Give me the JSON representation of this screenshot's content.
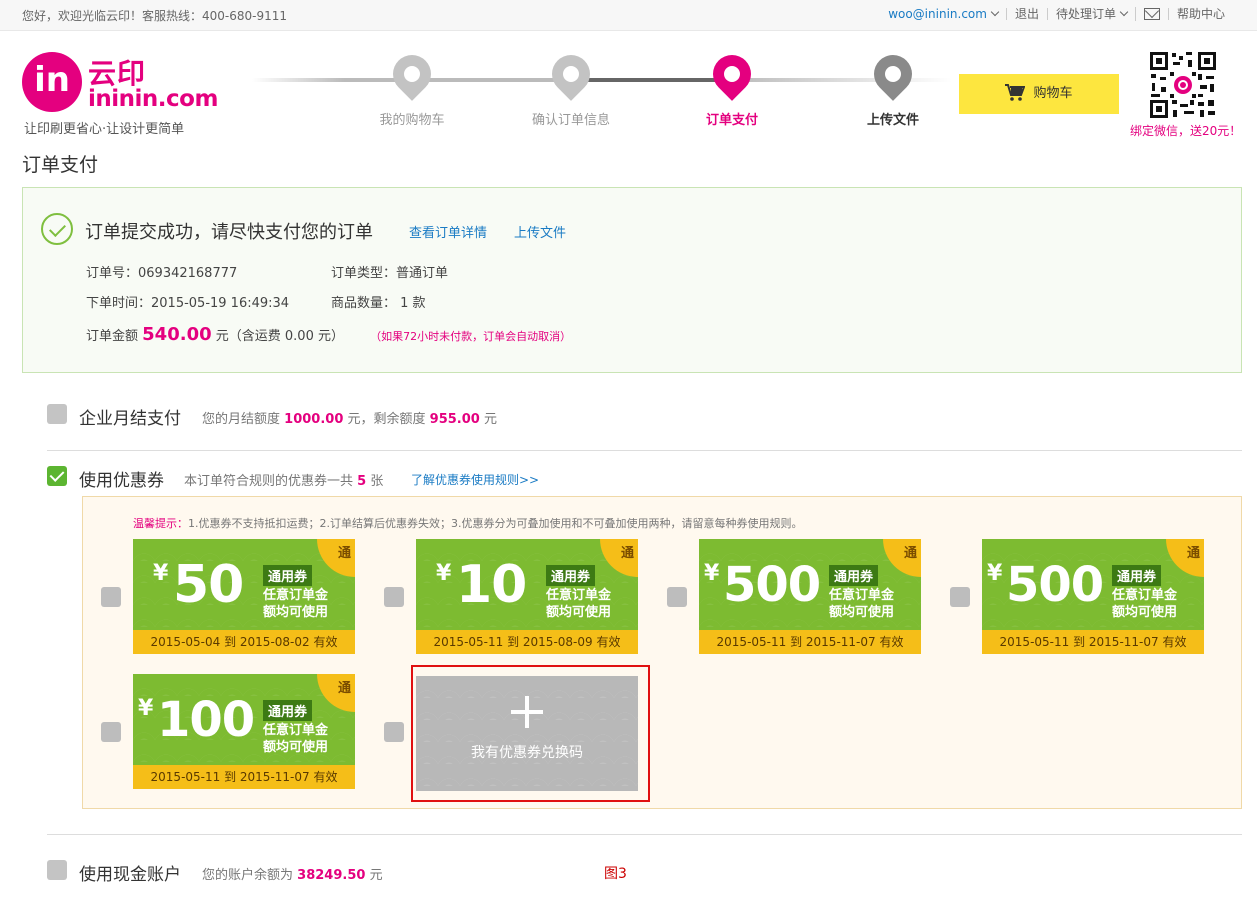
{
  "topbar": {
    "welcome": "您好，欢迎光临云印！客服热线：400-680-9111",
    "email": "woo@ininin.com",
    "logout": "退出",
    "pending": "待处理订单",
    "help": "帮助中心"
  },
  "logo": {
    "mark": "in",
    "cn": "云印",
    "en": "ininin.com",
    "slogan": "让印刷更省心·让设计更简单"
  },
  "steps": [
    {
      "label": "我的购物车",
      "state": "done"
    },
    {
      "label": "确认订单信息",
      "state": "done"
    },
    {
      "label": "订单支付",
      "state": "active"
    },
    {
      "label": "上传文件",
      "state": "todo"
    }
  ],
  "cart_label": "购物车",
  "qr_note": "绑定微信，送20元！",
  "page_title": "订单支付",
  "order": {
    "headline": "订单提交成功，请尽快支付您的订单",
    "view_detail": "查看订单详情",
    "upload": "上传文件",
    "number": "订单号：069342168777",
    "type": "订单类型：普通订单",
    "time": "下单时间：2015-05-19 16:49:34",
    "qty": "商品数量：  1 款",
    "amount_label": "订单金额",
    "amount": "540.00",
    "amount_suffix": "元（含运费 0.00 元）",
    "warning": "（如果72小时未付款，订单会自动取消）"
  },
  "enterprise": {
    "title": "企业月结支付",
    "note_a": "您的月结额度",
    "limit": "1000.00",
    "note_b": "元，剩余额度",
    "remain": "955.00",
    "note_c": "元"
  },
  "coupon_opt": {
    "title": "使用优惠券",
    "note_a": "本订单符合规则的优惠券一共",
    "count": "5",
    "note_b": "张",
    "link": "了解优惠券使用规则>>"
  },
  "tip": {
    "head": "温馨提示：",
    "text": "1.优惠券不支持抵扣运费；2.订单结算后优惠券失效；3.优惠券分为可叠加使用和不可叠加使用两种，请留意每种券使用规则。"
  },
  "coupons": [
    {
      "yen": "¥",
      "value": "50",
      "tag": "通用券",
      "line1": "任意订单金",
      "line2": "额均可使用",
      "corner": "通",
      "validity": "2015-05-04 到 2015-08-02 有效"
    },
    {
      "yen": "¥",
      "value": "10",
      "tag": "通用券",
      "line1": "任意订单金",
      "line2": "额均可使用",
      "corner": "通",
      "validity": "2015-05-11 到 2015-08-09 有效"
    },
    {
      "yen": "¥",
      "value": "500",
      "tag": "通用券",
      "line1": "任意订单金",
      "line2": "额均可使用",
      "corner": "通",
      "validity": "2015-05-11 到 2015-11-07 有效"
    },
    {
      "yen": "¥",
      "value": "500",
      "tag": "通用券",
      "line1": "任意订单金",
      "line2": "额均可使用",
      "corner": "通",
      "validity": "2015-05-11 到 2015-11-07 有效"
    },
    {
      "yen": "¥",
      "value": "100",
      "tag": "通用券",
      "line1": "任意订单金",
      "line2": "额均可使用",
      "corner": "通",
      "validity": "2015-05-11 到 2015-11-07 有效"
    }
  ],
  "redeem_label": "我有优惠券兑换码",
  "cash": {
    "title": "使用现金账户",
    "note_a": "您的账户余额为",
    "balance": "38249.50",
    "note_b": "元"
  },
  "figure_label": "图3",
  "colors": {
    "brand": "#e4007f",
    "coupon_green": "#7dbb31",
    "coupon_gold": "#f5be18",
    "link": "#1a7bc4"
  }
}
